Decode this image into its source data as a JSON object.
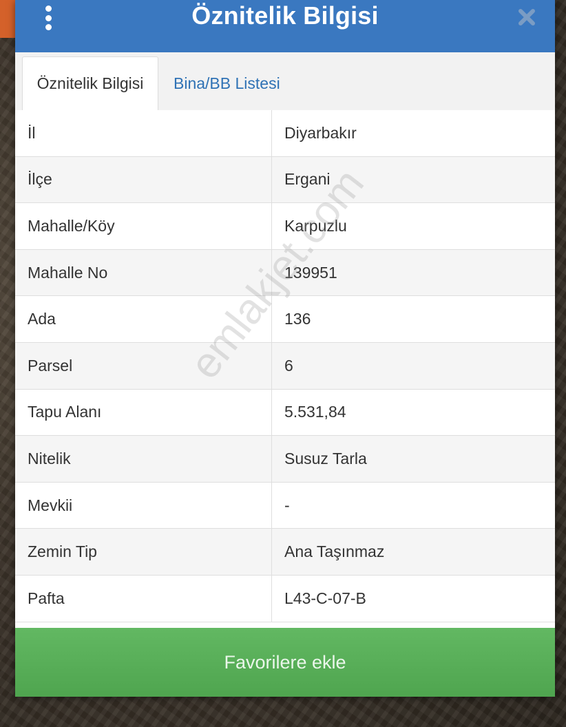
{
  "header": {
    "title": "Öznitelik Bilgisi"
  },
  "tabs": [
    {
      "label": "Öznitelik Bilgisi",
      "active": true
    },
    {
      "label": "Bina/BB Listesi",
      "active": false
    }
  ],
  "rows": [
    {
      "key": "İl",
      "value": "Diyarbakır"
    },
    {
      "key": "İlçe",
      "value": "Ergani"
    },
    {
      "key": "Mahalle/Köy",
      "value": "Karpuzlu"
    },
    {
      "key": "Mahalle No",
      "value": "139951"
    },
    {
      "key": "Ada",
      "value": "136"
    },
    {
      "key": "Parsel",
      "value": "6"
    },
    {
      "key": "Tapu Alanı",
      "value": "5.531,84"
    },
    {
      "key": "Nitelik",
      "value": "Susuz Tarla"
    },
    {
      "key": "Mevkii",
      "value": "-"
    },
    {
      "key": "Zemin Tip",
      "value": "Ana Taşınmaz"
    },
    {
      "key": "Pafta",
      "value": "L43-C-07-B"
    }
  ],
  "watermark": "emlakjet.com",
  "footer": {
    "button_label": "Favorilere ekle"
  },
  "colors": {
    "header": "#3a78c0",
    "button": "#5cb35c",
    "tab_link": "#2f72b5"
  },
  "icons": {
    "menu": "kebab-menu-icon",
    "close": "close-icon"
  }
}
